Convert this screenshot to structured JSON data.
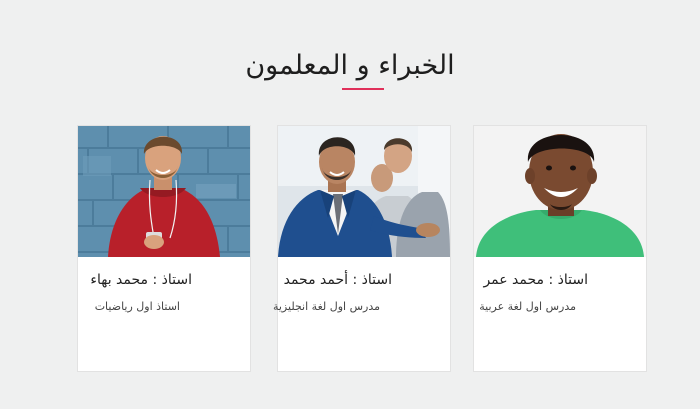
{
  "section": {
    "title": "الخبراء و المعلمون",
    "accent_color": "#e0305a"
  },
  "teachers": [
    {
      "name": "استاذ : محمد بهاء",
      "role": "استاذ اول رياضيات",
      "photo_icon": "teacher-photo-red-sweater"
    },
    {
      "name": "استاذ : أحمد محمد",
      "role": "مدرس اول لغة انجليزية",
      "photo_icon": "teacher-photo-blue-suit"
    },
    {
      "name": "استاذ : محمد عمر",
      "role": "مدرس اول لغة عربية",
      "photo_icon": "teacher-photo-green-shirt"
    }
  ]
}
